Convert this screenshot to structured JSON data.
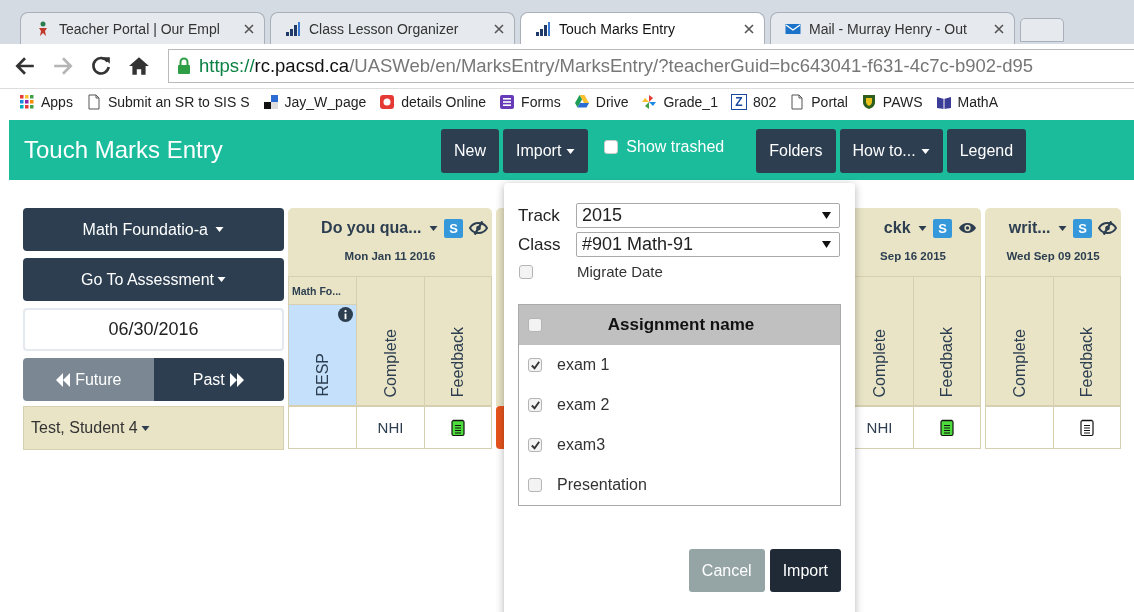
{
  "browser": {
    "tabs": [
      {
        "title": "Teacher Portal | Our Empl",
        "selected": false
      },
      {
        "title": "Class Lesson Organizer",
        "selected": false
      },
      {
        "title": "Touch Marks Entry",
        "selected": true
      },
      {
        "title": "Mail - Murray Henry - Out",
        "selected": false
      }
    ],
    "url": {
      "scheme": "https://",
      "host": "rc.pacsd.ca",
      "path": "/UASWeb/en/MarksEntry/MarksEntry/?teacherGuid=bc643041-f631-4c7c-b902-d95"
    },
    "bookmarks": [
      {
        "label": "Apps"
      },
      {
        "label": "Submit an SR to SIS S"
      },
      {
        "label": "Jay_W_page"
      },
      {
        "label": "details Online"
      },
      {
        "label": "Forms"
      },
      {
        "label": "Drive"
      },
      {
        "label": "Grade_1"
      },
      {
        "label": "802",
        "icon_text": "Z"
      },
      {
        "label": "Portal"
      },
      {
        "label": "PAWS"
      },
      {
        "label": "MathA"
      }
    ]
  },
  "app": {
    "title": "Touch Marks Entry",
    "toolbar": [
      {
        "kind": "button",
        "label": "New"
      },
      {
        "kind": "dropdown",
        "label": "Import"
      },
      {
        "kind": "checkbox",
        "label": "Show trashed",
        "checked": false
      },
      {
        "kind": "button",
        "label": "Folders"
      },
      {
        "kind": "dropdown",
        "label": "How to..."
      },
      {
        "kind": "button",
        "label": "Legend"
      }
    ]
  },
  "sidebar": {
    "class_dropdown": "Math Foundatio-a",
    "assessment_dropdown": "Go To Assessment",
    "date": "06/30/2016",
    "nav": [
      {
        "label": "Future",
        "disabled": true
      },
      {
        "label": "Past",
        "disabled": false
      }
    ],
    "student": "Test, Student 4"
  },
  "assessments": [
    {
      "kind": "card",
      "title": "Do you qua...",
      "badge": "S",
      "date": "Mon Jan 11 2016",
      "visible": false,
      "columns": [
        {
          "kind": "resp",
          "group": "Math Fo...",
          "label": "RESP"
        },
        {
          "kind": "text",
          "label": "Complete"
        },
        {
          "kind": "feedback",
          "label": "Feedback"
        }
      ],
      "cells": [
        {
          "kind": "text"
        },
        {
          "kind": "text",
          "value": "NHI"
        },
        {
          "kind": "feedback",
          "given": true
        }
      ]
    },
    {
      "kind": "covered"
    },
    {
      "kind": "card",
      "title": "ckk",
      "badge": "S",
      "date": "Sep 16 2015",
      "visible": true,
      "columns": [
        {
          "kind": "text",
          "label": "Complete"
        },
        {
          "kind": "feedback",
          "label": "Feedback"
        }
      ],
      "cells": [
        {
          "kind": "text",
          "value": "NHI"
        },
        {
          "kind": "feedback",
          "given": true
        }
      ]
    },
    {
      "kind": "card",
      "title": "writ...",
      "badge": "S",
      "date": "Wed Sep 09 2015",
      "visible": false,
      "columns": [
        {
          "kind": "text",
          "label": "Complete"
        },
        {
          "kind": "feedback",
          "label": "Feedback"
        }
      ],
      "cells": [
        {
          "kind": "text"
        },
        {
          "kind": "feedback",
          "given": false
        }
      ]
    }
  ],
  "import_popup": {
    "track_label": "Track",
    "track": "2015",
    "class_label": "Class",
    "class": "#901 Math-91",
    "migrate_date": {
      "label": "Migrate Date",
      "checked": false
    },
    "table": {
      "header": "Assignment name",
      "select_all": false,
      "items": [
        {
          "name": "exam 1",
          "checked": true
        },
        {
          "name": "exam 2",
          "checked": true
        },
        {
          "name": "exam3",
          "checked": true
        },
        {
          "name": "Presentation",
          "checked": false
        }
      ]
    },
    "buttons": [
      {
        "kind": "cancel",
        "label": "Cancel"
      },
      {
        "kind": "primary",
        "label": "Import"
      }
    ]
  }
}
